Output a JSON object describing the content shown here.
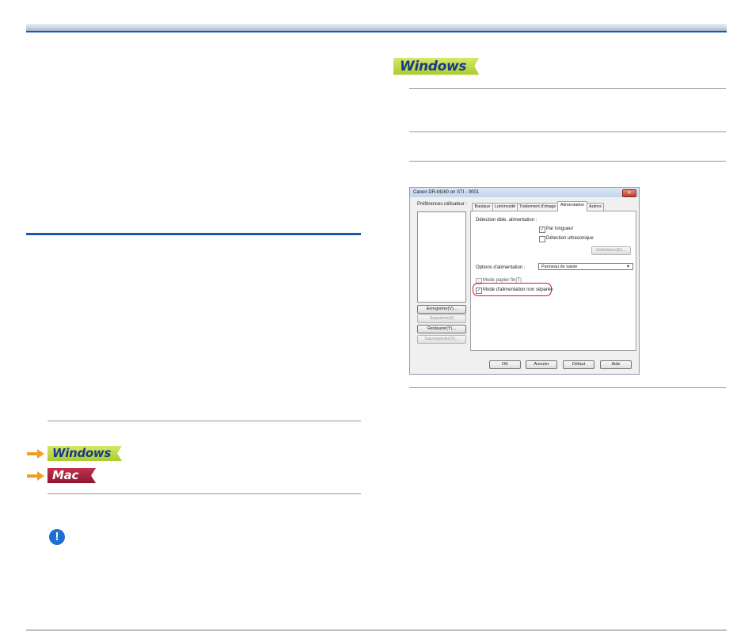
{
  "badges": {
    "windows_label": "Windows",
    "mac_label": "Mac"
  },
  "colors": {
    "accent_blue": "#1d5aa6",
    "windows_badge_green": "#a9cb2e",
    "mac_badge_red": "#8f1530",
    "arrow_orange": "#f0a020",
    "highlight_red": "#e0141c"
  },
  "icons": {
    "warning": "exclamation-circle-icon",
    "arrow": "right-arrow-icon"
  },
  "dialog": {
    "title": "Canon DR-M160 on STI - 0001",
    "close_label": "✕",
    "user_prefs_label": "Préférences utilisateur :",
    "buttons_left": [
      {
        "label": "Enregistrer(V)...",
        "enabled": true
      },
      {
        "label": "Supprimer(I)",
        "enabled": false
      },
      {
        "label": "Restaurer(Y)...",
        "enabled": true
      },
      {
        "label": "Sauvegarder(X)...",
        "enabled": false
      }
    ],
    "tabs": [
      {
        "label": "Basique",
        "active": false
      },
      {
        "label": "Luminosité",
        "active": false
      },
      {
        "label": "Traitement d'image",
        "active": false
      },
      {
        "label": "Alimentation",
        "active": true
      },
      {
        "label": "Autres",
        "active": false
      }
    ],
    "double_feed_label": "Détection dble. alimentation :",
    "by_length_label": "Par longueur",
    "by_length_checked": true,
    "ultrasonic_label": "Détection ultrasonique",
    "ultrasonic_checked": false,
    "definitions_label": "Définitions(E)...",
    "feed_options_label": "Options d'alimentation :",
    "feed_options_value": "Panneau de saisie",
    "thin_paper_label": "Mode papier fin(T)",
    "thin_paper_checked": false,
    "separation_label": "Mode d'alimentation non séparée",
    "separation_checked": true,
    "ok_label": "OK",
    "cancel_label": "Annuler",
    "default_label": "Défaut",
    "help_label": "Aide"
  }
}
